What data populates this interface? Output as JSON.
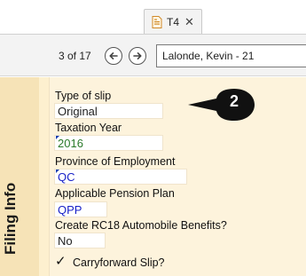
{
  "tab": {
    "title": "T4",
    "icon": "document-form-icon",
    "close_glyph": "✕"
  },
  "toolbar": {
    "record_counter": "3 of 17",
    "prev_icon": "arrow-left-icon",
    "next_icon": "arrow-right-icon",
    "client_name": "Lalonde, Kevin - 21"
  },
  "section": {
    "title": "Filing Info"
  },
  "fields": {
    "type_of_slip": {
      "label": "Type of slip",
      "value": "Original"
    },
    "taxation_year": {
      "label": "Taxation Year",
      "value": "2016"
    },
    "province": {
      "label": "Province of Employment",
      "value": "QC"
    },
    "pension_plan": {
      "label": "Applicable Pension Plan",
      "value": "QPP"
    },
    "rc18": {
      "label": "Create RC18 Automobile Benefits?",
      "value": "No"
    },
    "carryforward": {
      "label": "Carryforward Slip?",
      "checked_glyph": "✓"
    }
  },
  "callout": {
    "number": "2"
  },
  "colors": {
    "side_band": "#f6e3b7",
    "content_bg": "#fdf3dc",
    "value_green": "#2a7a2a",
    "value_blue": "#1a23c8",
    "callout_bg": "#111111"
  }
}
